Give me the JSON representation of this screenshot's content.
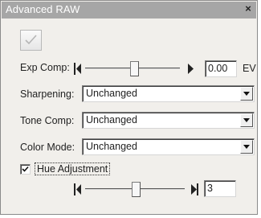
{
  "window": {
    "title": "Advanced RAW",
    "close_glyph": "×"
  },
  "apply_button": {
    "icon": "checkmark-icon",
    "enabled": false
  },
  "exposure": {
    "label": "Exp Comp:",
    "value": "0.00",
    "unit": "EV",
    "slider_position": 0.5
  },
  "sharpening": {
    "label": "Sharpening:",
    "value": "Unchanged"
  },
  "tone_comp": {
    "label": "Tone Comp:",
    "value": "Unchanged"
  },
  "color_mode": {
    "label": "Color Mode:",
    "value": "Unchanged"
  },
  "hue": {
    "checkbox_label": "Hue Adjustment",
    "checked": true,
    "value": "3",
    "slider_position": 0.55
  },
  "colors": {
    "panel_bg": "#f1efeb",
    "titlebar_bg": "#a6a6a6",
    "title_text": "#ffffff"
  }
}
